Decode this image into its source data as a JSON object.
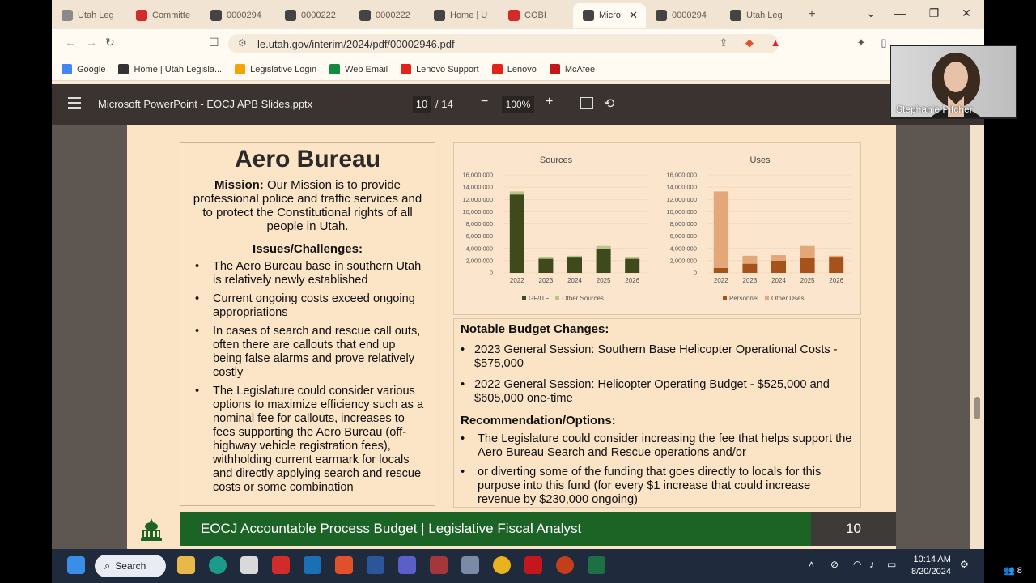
{
  "browser": {
    "tabs": [
      {
        "label": "Utah Leg",
        "color": "#8a8a8a"
      },
      {
        "label": "Committe",
        "color": "#d12b2b"
      },
      {
        "label": "0000294",
        "color": "#444"
      },
      {
        "label": "0000222",
        "color": "#444"
      },
      {
        "label": "0000222",
        "color": "#444"
      },
      {
        "label": "Home | U",
        "color": "#444"
      },
      {
        "label": "COBI",
        "color": "#d12b2b"
      },
      {
        "label": "Micro",
        "color": "#444",
        "active": true
      },
      {
        "label": "0000294",
        "color": "#444"
      },
      {
        "label": "Utah Leg",
        "color": "#444"
      }
    ],
    "url": "le.utah.gov/interim/2024/pdf/00002946.pdf",
    "bookmarks": [
      {
        "label": "Google",
        "color": "#4285f4"
      },
      {
        "label": "Home | Utah Legisla...",
        "color": "#333"
      },
      {
        "label": "Legislative Login",
        "color": "#f4a300"
      },
      {
        "label": "Web Email",
        "color": "#0f8a3e"
      },
      {
        "label": "Lenovo Support",
        "color": "#e2231a"
      },
      {
        "label": "Lenovo",
        "color": "#e2231a"
      },
      {
        "label": "McAfee",
        "color": "#c01818"
      }
    ]
  },
  "pdf_toolbar": {
    "title": "Microsoft PowerPoint - EOCJ APB Slides.pptx",
    "page": "10",
    "total": "/  14",
    "zoom": "100%"
  },
  "slide": {
    "title": "Aero Bureau",
    "mission_label": "Mission:",
    "mission_text": " Our Mission is to provide professional police and traffic services and to protect the Constitutional rights of all people in Utah.",
    "issues_heading": "Issues/Challenges:",
    "issues": [
      "The Aero Bureau base in southern Utah is relatively newly established",
      "Current ongoing costs exceed ongoing appropriations",
      "In cases of search and rescue call outs, often there are callouts that end up being false alarms and prove relatively costly",
      "The Legislature could consider various options to maximize efficiency such as a nominal fee for callouts, increases to fees supporting the Aero Bureau (off-highway vehicle registration fees), withholding current earmark for locals and directly applying search and rescue costs or some combination"
    ],
    "notable_heading": "Notable Budget Changes:",
    "notable": [
      "2023 General Session: Southern Base Helicopter Operational Costs - $575,000",
      "2022 General Session: Helicopter Operating Budget - $525,000 and $605,000 one-time"
    ],
    "recommendation_heading": "Recommendation/Options:",
    "recommendations": [
      "The Legislature could consider increasing the fee that helps support the Aero Bureau Search and Rescue operations and/or",
      "or diverting some of the funding that goes directly to locals for this purpose into this fund (for every $1 increase that could increase revenue by $230,000 ongoing)"
    ],
    "footer": "EOCJ Accountable Process Budget | Legislative Fiscal Analyst",
    "page_number": "10"
  },
  "chart_data": [
    {
      "type": "bar",
      "stacked": true,
      "title": "Sources",
      "categories": [
        "2022",
        "2023",
        "2024",
        "2025",
        "2026"
      ],
      "ylim": [
        0,
        16000000
      ],
      "yticks": [
        "0",
        "2,000,000",
        "4,000,000",
        "6,000,000",
        "8,000,000",
        "10,000,000",
        "12,000,000",
        "14,000,000",
        "16,000,000"
      ],
      "series": [
        {
          "name": "GF/ITF",
          "color": "#3f4a1c",
          "values": [
            12800000,
            2300000,
            2500000,
            3900000,
            2300000
          ]
        },
        {
          "name": "Other Sources",
          "color": "#b9c58a",
          "values": [
            500000,
            300000,
            300000,
            500000,
            300000
          ]
        }
      ]
    },
    {
      "type": "bar",
      "stacked": true,
      "title": "Uses",
      "categories": [
        "2022",
        "2023",
        "2024",
        "2025",
        "2026"
      ],
      "ylim": [
        0,
        16000000
      ],
      "yticks": [
        "0",
        "2,000,000",
        "4,000,000",
        "6,000,000",
        "8,000,000",
        "10,000,000",
        "12,000,000",
        "14,000,000",
        "16,000,000"
      ],
      "series": [
        {
          "name": "Personnel",
          "color": "#a5521b",
          "values": [
            800000,
            1500000,
            2000000,
            2400000,
            2500000
          ]
        },
        {
          "name": "Other Uses",
          "color": "#e3a779",
          "values": [
            12500000,
            1300000,
            900000,
            2000000,
            300000
          ]
        }
      ]
    }
  ],
  "webcam": {
    "name": "Stephanie Pitcher"
  },
  "taskbar": {
    "search_label": "Search",
    "time": "10:14 AM",
    "date": "8/20/2024",
    "people_count": "8"
  }
}
